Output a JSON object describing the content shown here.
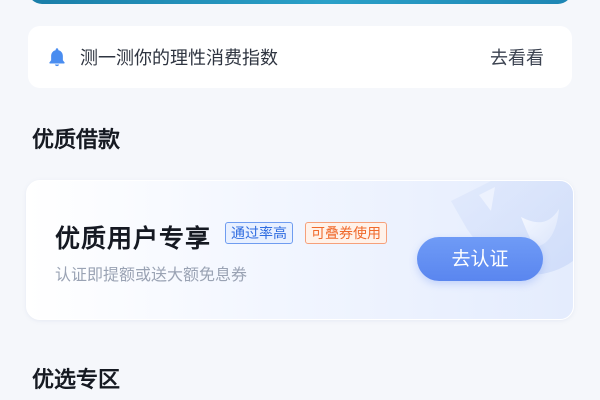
{
  "notice": {
    "text": "测一测你的理性消费指数",
    "link_label": "去看看",
    "icon": "bell-icon"
  },
  "sections": {
    "loan_title": "优质借款",
    "zone_title": "优选专区"
  },
  "premium_card": {
    "title": "优质用户专享",
    "tags": [
      "通过率高",
      "可叠券使用"
    ],
    "subtitle": "认证即提额或送大额免息券",
    "button_label": "去认证"
  },
  "colors": {
    "accent_blue": "#5a86ef",
    "tag_blue": "#2f6ce0",
    "tag_orange": "#f06a2c",
    "bell": "#4a8df0"
  }
}
